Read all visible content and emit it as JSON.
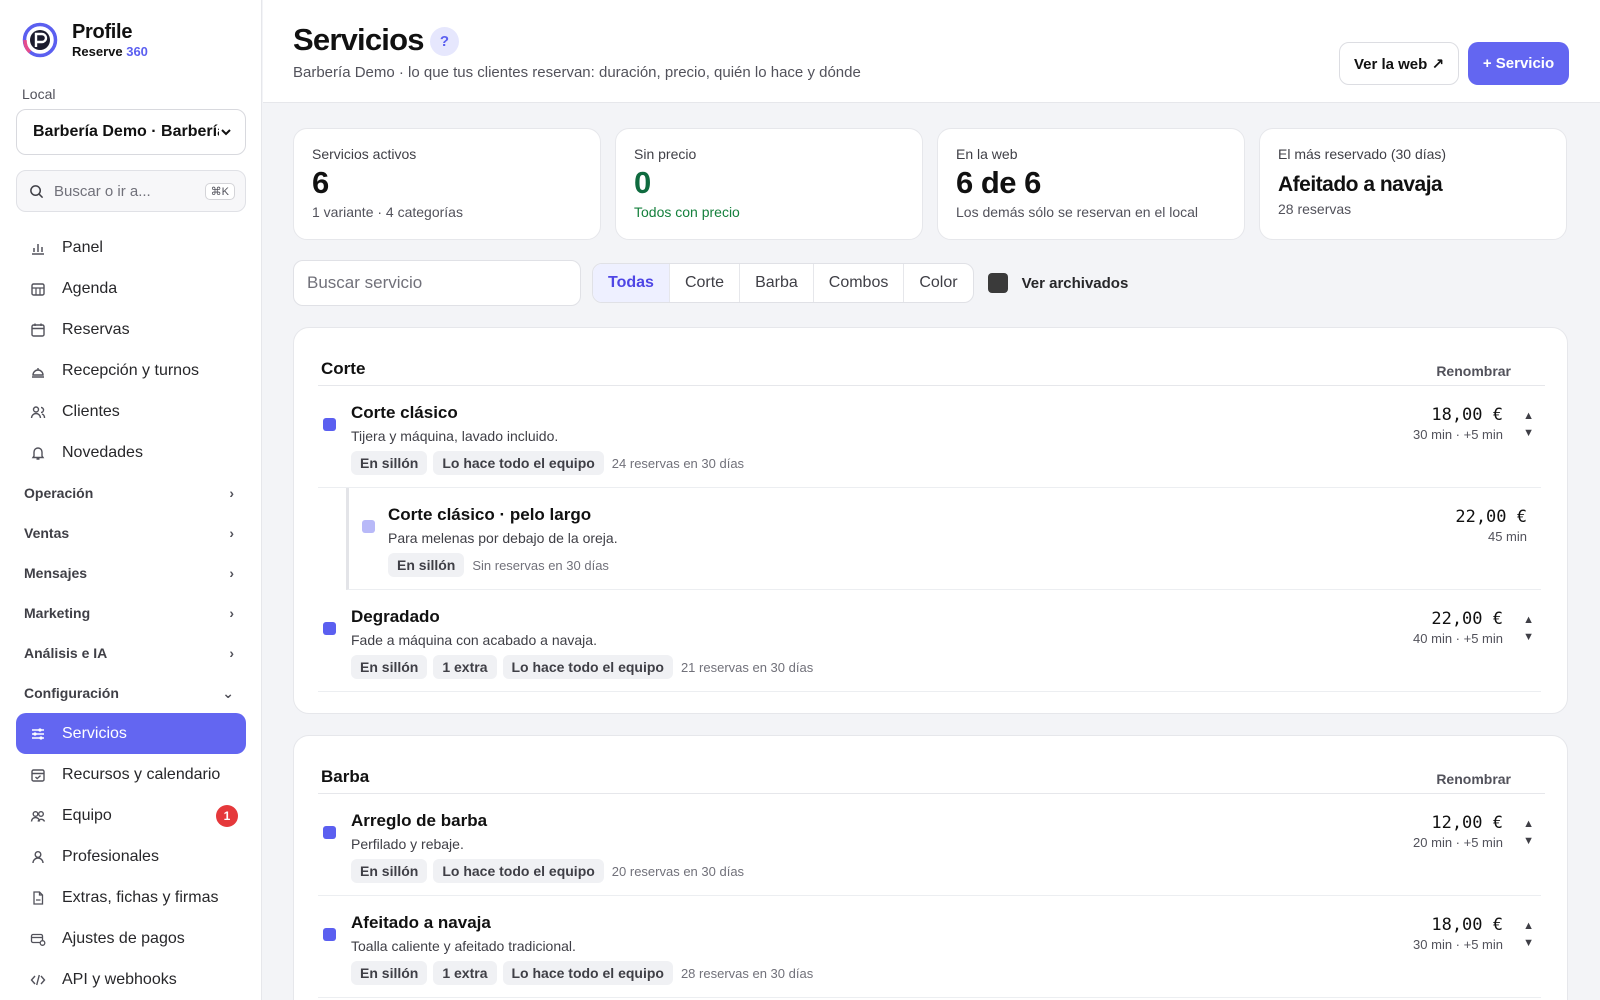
{
  "brand": {
    "name": "Profile",
    "sub_prefix": "Reserve ",
    "sub_accent": "360",
    "accent_color": "#5b5ff0"
  },
  "sidebar": {
    "local_label": "Local",
    "local_value": "Barbería Demo · Barbería Demo",
    "search_placeholder": "Buscar o ir a...",
    "search_shortcut": "⌘K",
    "items_top": [
      {
        "label": "Panel",
        "icon": "chart-icon"
      },
      {
        "label": "Agenda",
        "icon": "calendar-grid-icon"
      },
      {
        "label": "Reservas",
        "icon": "calendar-icon"
      },
      {
        "label": "Recepción y turnos",
        "icon": "bell-desk-icon"
      },
      {
        "label": "Clientes",
        "icon": "users-icon"
      },
      {
        "label": "Novedades",
        "icon": "bell-icon"
      }
    ],
    "groups": [
      {
        "label": "Operación"
      },
      {
        "label": "Ventas"
      },
      {
        "label": "Mensajes"
      },
      {
        "label": "Marketing"
      },
      {
        "label": "Análisis e IA"
      },
      {
        "label": "Configuración"
      }
    ],
    "items_config": [
      {
        "label": "Servicios",
        "icon": "sliders-icon",
        "active": true
      },
      {
        "label": "Recursos y calendario",
        "icon": "calendar-check-icon"
      },
      {
        "label": "Equipo",
        "icon": "team-icon",
        "badge": "1"
      },
      {
        "label": "Profesionales",
        "icon": "user-icon"
      },
      {
        "label": "Extras, fichas y firmas",
        "icon": "document-icon"
      },
      {
        "label": "Ajustes de pagos",
        "icon": "card-icon"
      },
      {
        "label": "API y webhooks",
        "icon": "code-icon"
      }
    ]
  },
  "header": {
    "title": "Servicios",
    "help": "?",
    "subtitle": "Barbería Demo · lo que tus clientes reservan: duración, precio, quién lo hace y dónde",
    "view_web": "Ver la web ↗",
    "add_service": "+ Servicio"
  },
  "stats": [
    {
      "label": "Servicios activos",
      "value": "6",
      "note": "1 variante · 4 categorías"
    },
    {
      "label": "Sin precio",
      "value": "0",
      "note": "Todos con precio",
      "color": "#15803d"
    },
    {
      "label": "En la web",
      "value": "6 de 6",
      "note": "Los demás sólo se reservan en el local"
    },
    {
      "label": "El más reservado (30 días)",
      "value": "Afeitado a navaja",
      "note": "28 reservas"
    }
  ],
  "filters": {
    "search_placeholder": "Buscar servicio",
    "tabs": [
      "Todas",
      "Corte",
      "Barba",
      "Combos",
      "Color"
    ],
    "active_tab": "Todas",
    "archived_label": "Ver archivados"
  },
  "categories": [
    {
      "title": "Corte",
      "action": "Renombrar",
      "services": [
        {
          "name": "Corte clásico",
          "desc": "Tijera y máquina, lavado incluido.",
          "tags": [
            "En sillón",
            "Lo hace todo el equipo"
          ],
          "usage": "24 reservas en 30 días",
          "price": "18,00 €",
          "duration": "30 min · +5 min"
        },
        {
          "name": "Corte clásico · pelo largo",
          "desc": "Para melenas por debajo de la oreja.",
          "tags": [
            "En sillón"
          ],
          "usage": "Sin reservas en 30 días",
          "price": "22,00 €",
          "duration": "45 min"
        },
        {
          "name": "Degradado",
          "desc": "Fade a máquina con acabado a navaja.",
          "tags": [
            "En sillón",
            "1 extra",
            "Lo hace todo el equipo"
          ],
          "usage": "21 reservas en 30 días",
          "price": "22,00 €",
          "duration": "40 min · +5 min"
        }
      ]
    },
    {
      "title": "Barba",
      "action": "Renombrar",
      "services": [
        {
          "name": "Arreglo de barba",
          "desc": "Perfilado y rebaje.",
          "tags": [
            "En sillón",
            "Lo hace todo el equipo"
          ],
          "usage": "20 reservas en 30 días",
          "price": "12,00 €",
          "duration": "20 min · +5 min"
        },
        {
          "name": "Afeitado a navaja",
          "desc": "Toalla caliente y afeitado tradicional.",
          "tags": [
            "En sillón",
            "1 extra",
            "Lo hace todo el equipo"
          ],
          "usage": "28 reservas en 30 días",
          "price": "18,00 €",
          "duration": "30 min · +5 min"
        }
      ]
    }
  ]
}
